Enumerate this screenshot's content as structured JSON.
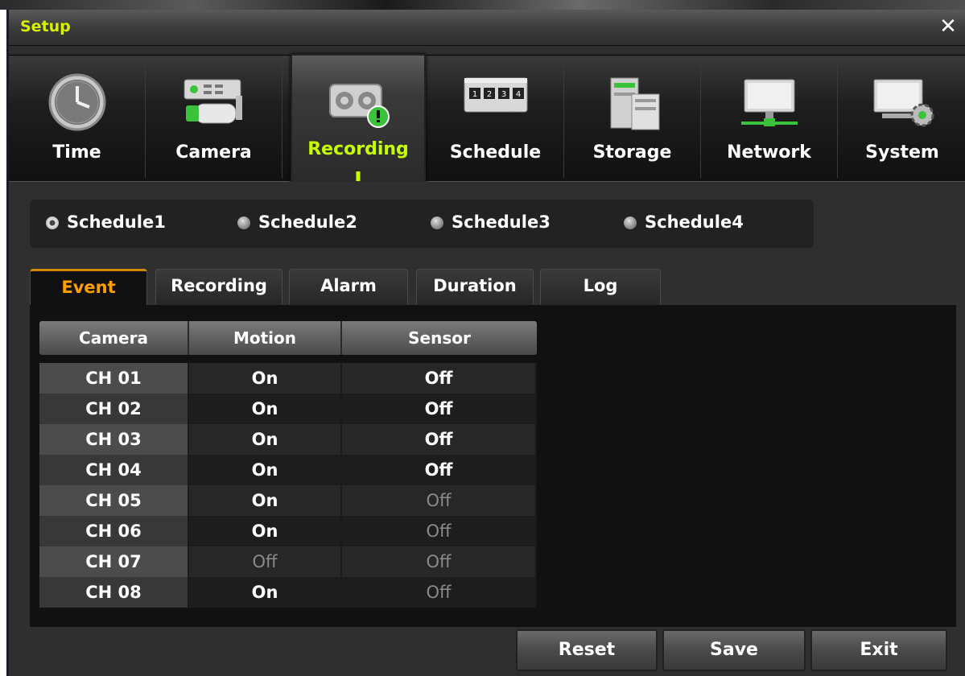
{
  "window": {
    "title": "Setup",
    "close_icon": "close-icon"
  },
  "menu": {
    "items": [
      {
        "label": "Time",
        "icon": "clock-icon"
      },
      {
        "label": "Camera",
        "icon": "camera-icon"
      },
      {
        "label": "Recording",
        "icon": "recording-icon",
        "active": true
      },
      {
        "label": "Schedule",
        "icon": "schedule-icon"
      },
      {
        "label": "Storage",
        "icon": "storage-icon"
      },
      {
        "label": "Network",
        "icon": "network-icon"
      },
      {
        "label": "System",
        "icon": "system-icon"
      }
    ]
  },
  "schedule_selector": {
    "options": [
      "Schedule1",
      "Schedule2",
      "Schedule3",
      "Schedule4"
    ],
    "selected": "Schedule1"
  },
  "tabs": {
    "items": [
      "Event",
      "Recording",
      "Alarm",
      "Duration",
      "Log"
    ],
    "active": "Event"
  },
  "table": {
    "headers": [
      "Camera",
      "Motion",
      "Sensor"
    ],
    "rows": [
      {
        "camera": "CH 01",
        "motion": "On",
        "sensor": "Off"
      },
      {
        "camera": "CH 02",
        "motion": "On",
        "sensor": "Off"
      },
      {
        "camera": "CH 03",
        "motion": "On",
        "sensor": "Off"
      },
      {
        "camera": "CH 04",
        "motion": "On",
        "sensor": "Off"
      },
      {
        "camera": "CH 05",
        "motion": "On",
        "sensor": "Off"
      },
      {
        "camera": "CH 06",
        "motion": "On",
        "sensor": "Off"
      },
      {
        "camera": "CH 07",
        "motion": "Off",
        "sensor": "Off"
      },
      {
        "camera": "CH 08",
        "motion": "On",
        "sensor": "Off"
      }
    ]
  },
  "buttons": {
    "reset": "Reset",
    "save": "Save",
    "exit": "Exit"
  },
  "colors": {
    "title_accent": "#d6f000",
    "active_menu": "#c8ff00",
    "active_tab": "#ffa000",
    "dimmed_value": "#8a8a8a"
  }
}
